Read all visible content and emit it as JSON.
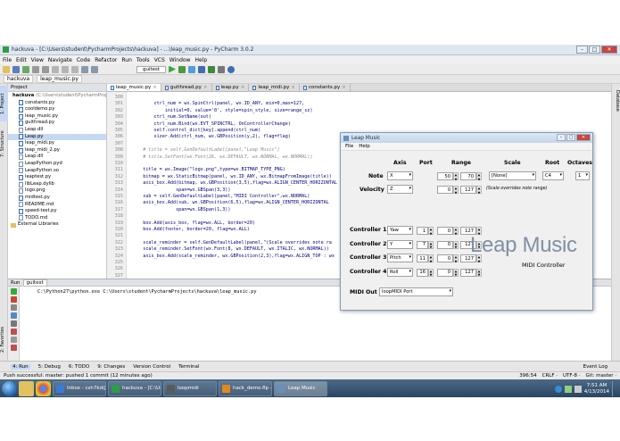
{
  "ide": {
    "window_title": "hackuva - [C:\\Users\\student\\PycharmProjects\\hackuva] - ...\\leap_music.py - PyCharm 3.0.2",
    "menu": [
      "File",
      "Edit",
      "View",
      "Navigate",
      "Code",
      "Refactor",
      "Run",
      "Tools",
      "VCS",
      "Window",
      "Help"
    ],
    "run_config": "guitest",
    "breadcrumbs": [
      "hackuva",
      "leap_music.py"
    ],
    "project_header": "Project",
    "project_tree": [
      {
        "label": "hackuva",
        "extra": "(C:\\Users\\student\\PycharmProjects\\hackuva)",
        "kind": "folder"
      },
      {
        "label": "constants.py",
        "kind": "py"
      },
      {
        "label": "cooldemo.py",
        "kind": "py"
      },
      {
        "label": "leap_music.py",
        "kind": "py"
      },
      {
        "label": "guithread.py",
        "kind": "py"
      },
      {
        "label": "Leap.dll",
        "kind": "file"
      },
      {
        "label": "Leap.py",
        "kind": "py",
        "selected": true
      },
      {
        "label": "leap_midi.py",
        "kind": "py"
      },
      {
        "label": "leap_midi_2.py",
        "kind": "py"
      },
      {
        "label": "Leap.dll",
        "kind": "file"
      },
      {
        "label": "LeapPython.pyd",
        "kind": "file"
      },
      {
        "label": "LeapPython.so",
        "kind": "file"
      },
      {
        "label": "leaptest.py",
        "kind": "py"
      },
      {
        "label": "libLeap.dylib",
        "kind": "file"
      },
      {
        "label": "logo.png",
        "kind": "file"
      },
      {
        "label": "midtest.py",
        "kind": "py"
      },
      {
        "label": "README.md",
        "kind": "file"
      },
      {
        "label": "speed-test.py",
        "kind": "py"
      },
      {
        "label": "TODO.md",
        "kind": "file"
      },
      {
        "label": "External Libraries",
        "kind": "lib"
      }
    ],
    "editor_tabs": [
      "leap_music.py",
      "guithread.py",
      "leap.py",
      "leap_midi.py",
      "constants.py"
    ],
    "code_lines": [
      {
        "n": "300",
        "t": ""
      },
      {
        "n": "301",
        "t": "        ctrl_num = wx.SpinCtrl(panel, wx.ID_ANY, min=0,max=127,"
      },
      {
        "n": "302",
        "t": "            initial=0, value='0', style=spin_style, size=range_sz)"
      },
      {
        "n": "303",
        "t": "        ctrl_num.SetName(out)"
      },
      {
        "n": "304",
        "t": "        ctrl_num.Bind(wx.EVT_SPINCTRL, OnControllerChange)"
      },
      {
        "n": "305",
        "t": "        self.control_dict[key].append(ctrl_num)"
      },
      {
        "n": "306",
        "t": "        sizer.Add(ctrl_num, wx.GBPosition(y,2), flag=flag)"
      },
      {
        "n": "307",
        "t": ""
      },
      {
        "n": "308",
        "t": "    # title = self.GenDefaultLabel(panel,\"Leap Music\")",
        "c": true
      },
      {
        "n": "309",
        "t": "    # title.SetFont(wx.Font(26, wx.DEFAULT, wx.NORMAL, wx.NORMAL))",
        "c": true
      },
      {
        "n": "310",
        "t": ""
      },
      {
        "n": "311",
        "t": "    title = wx.Image(\"logo.png\",type=wx.BITMAP_TYPE_PNG)"
      },
      {
        "n": "312",
        "t": "    bitmap = wx.StaticBitmap(panel, wx.ID_ANY, wx.BitmapFromImage(title))"
      },
      {
        "n": "313",
        "t": "    axis_box.Add(bitmap, wx.GBPosition(3,5),flag=wx.ALIGN_CENTER_HORIZONTAL"
      },
      {
        "n": "314",
        "t": "                span=wx.GBSpan(3,3))"
      },
      {
        "n": "315",
        "t": "    sub = self.GenDefaultLabel(panel,\"MIDI Controller\",wx.NORMAL)"
      },
      {
        "n": "316",
        "t": "    axis_box.Add(sub, wx.GBPosition(6,5),flag=wx.ALIGN_CENTER_HORIZONTAL"
      },
      {
        "n": "317",
        "t": "                span=wx.GBSpan(1,3))"
      },
      {
        "n": "318",
        "t": ""
      },
      {
        "n": "319",
        "t": "    box.Add(axis_box, flag=wx.ALL, border=20)"
      },
      {
        "n": "320",
        "t": "    box.Add(footer, border=20, flag=wx.ALL)"
      },
      {
        "n": "321",
        "t": ""
      },
      {
        "n": "322",
        "t": "    scale_reminder = self.GenDefaultLabel(panel,\"(Scale overrides note ra"
      },
      {
        "n": "323",
        "t": "    scale_reminder.SetFont(wx.Font(8, wx.DEFAULT, wx.ITALIC, wx.NORMAL))"
      },
      {
        "n": "324",
        "t": "    axis_box.Add(scale_reminder, wx.GBPosition(2,3),flag=wx.ALIGN_TOP : wx"
      },
      {
        "n": "325",
        "t": ""
      },
      {
        "n": "326",
        "t": ""
      },
      {
        "n": "327",
        "t": ""
      }
    ],
    "run_tab": "Run",
    "run_config_tab": "guitest",
    "run_output": "C:\\Python27\\python.exe C:\\Users\\student\\PycharmProjects\\hackuva\\leap_music.py",
    "bottom_tabs": [
      "4: Run",
      "5: Debug",
      "6: TODO",
      "9: Changes",
      "Version Control",
      "Terminal"
    ],
    "event_log": "Event Log",
    "status_left": "Push successful: master: pushed 1 commit (12 minutes ago)",
    "status_right": [
      "396:54",
      "CRLF ‧",
      "UTF-8 ‧",
      "Git: master ‧"
    ],
    "left_tool_tabs": [
      "1: Project",
      "7: Structure",
      "2: Favorites"
    ],
    "right_tool_tabs": [
      "Database"
    ]
  },
  "leap_music": {
    "title": "Leap Music",
    "menu": [
      "File",
      "Help"
    ],
    "headers": {
      "axis": "Axis",
      "port": "Port",
      "range": "Range",
      "scale": "Scale",
      "root": "Root",
      "octaves": "Octaves"
    },
    "note": {
      "label": "Note",
      "axis": "X",
      "range_min": "50",
      "range_max": "70",
      "scale": "[None]",
      "root": "C4",
      "octaves": "1"
    },
    "velocity": {
      "label": "Velocity",
      "axis": "Z",
      "range_min": "0",
      "range_max": "127"
    },
    "scale_hint": "(Scale overrides note range)",
    "controllers": [
      {
        "label": "Controller 1",
        "axis": "Yaw",
        "port": "1",
        "min": "0",
        "max": "127"
      },
      {
        "label": "Controller 2",
        "axis": "Y",
        "port": "7",
        "min": "0",
        "max": "127"
      },
      {
        "label": "Controller 3",
        "axis": "Pitch",
        "port": "11",
        "min": "0",
        "max": "127"
      },
      {
        "label": "Controller 4",
        "axis": "Roll",
        "port": "16",
        "min": "0",
        "max": "127"
      }
    ],
    "logo_text": "Leap Music",
    "subtitle": "MIDI Controller",
    "midi_out_label": "MIDI Out",
    "midi_out_value": "loopMIDI Port"
  },
  "taskbar": {
    "buttons": [
      {
        "label": "Inbox - csh7kd@v...",
        "color": "#3a7bd5"
      },
      {
        "label": "hackuva - [C:\\Use...",
        "color": "#2e9d4a"
      },
      {
        "label": "loopmidi",
        "color": "#5a5a5a"
      },
      {
        "label": "hack_demo.flp - F...",
        "color": "#e08a1e"
      },
      {
        "label": "Leap Music",
        "color": "#6a8fb8",
        "active": true
      }
    ],
    "time": "7:51 AM",
    "date": "4/13/2014"
  },
  "colors": {
    "accent": "#3d6db3",
    "titlebar": "#dfe7f1",
    "taskbar": "#2b4561",
    "close": "#c8473a"
  }
}
